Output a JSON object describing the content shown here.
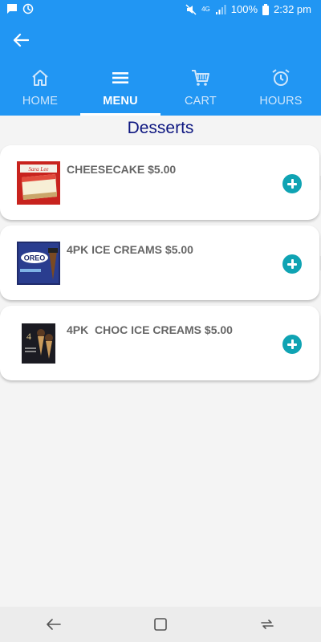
{
  "status_bar": {
    "battery": "100%",
    "time": "2:32 pm",
    "network": "4G"
  },
  "header": {
    "back_icon": "arrow-left-icon"
  },
  "tabs": [
    {
      "label": "HOME",
      "icon": "home-icon",
      "active": false
    },
    {
      "label": "MENU",
      "icon": "menu-icon",
      "active": true
    },
    {
      "label": "CART",
      "icon": "cart-icon",
      "active": false
    },
    {
      "label": "HOURS",
      "icon": "alarm-clock-icon",
      "active": false
    }
  ],
  "page": {
    "title": "Desserts"
  },
  "items": [
    {
      "name": "CHEESECAKE $5.00",
      "image": "sara-lee-cheesecake-box"
    },
    {
      "name": "4PK ICE CREAMS $5.00",
      "image": "oreo-ice-cream-box"
    },
    {
      "name": "4PK  CHOC ICE CREAMS $5.00",
      "image": "choc-ice-cream-box"
    }
  ],
  "colors": {
    "primary": "#2196f3",
    "title": "#0d1680",
    "add_button": "#0fa3b3",
    "background": "#f4f4f4"
  }
}
